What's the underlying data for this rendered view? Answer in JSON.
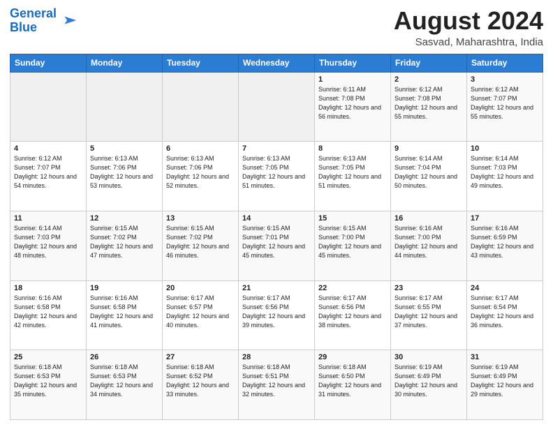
{
  "header": {
    "logo_line1": "General",
    "logo_line2": "Blue",
    "month": "August 2024",
    "location": "Sasvad, Maharashtra, India"
  },
  "weekdays": [
    "Sunday",
    "Monday",
    "Tuesday",
    "Wednesday",
    "Thursday",
    "Friday",
    "Saturday"
  ],
  "weeks": [
    [
      {
        "day": "",
        "empty": true
      },
      {
        "day": "",
        "empty": true
      },
      {
        "day": "",
        "empty": true
      },
      {
        "day": "",
        "empty": true
      },
      {
        "day": "1",
        "sunrise": "Sunrise: 6:11 AM",
        "sunset": "Sunset: 7:08 PM",
        "daylight": "Daylight: 12 hours and 56 minutes."
      },
      {
        "day": "2",
        "sunrise": "Sunrise: 6:12 AM",
        "sunset": "Sunset: 7:08 PM",
        "daylight": "Daylight: 12 hours and 55 minutes."
      },
      {
        "day": "3",
        "sunrise": "Sunrise: 6:12 AM",
        "sunset": "Sunset: 7:07 PM",
        "daylight": "Daylight: 12 hours and 55 minutes."
      }
    ],
    [
      {
        "day": "4",
        "sunrise": "Sunrise: 6:12 AM",
        "sunset": "Sunset: 7:07 PM",
        "daylight": "Daylight: 12 hours and 54 minutes."
      },
      {
        "day": "5",
        "sunrise": "Sunrise: 6:13 AM",
        "sunset": "Sunset: 7:06 PM",
        "daylight": "Daylight: 12 hours and 53 minutes."
      },
      {
        "day": "6",
        "sunrise": "Sunrise: 6:13 AM",
        "sunset": "Sunset: 7:06 PM",
        "daylight": "Daylight: 12 hours and 52 minutes."
      },
      {
        "day": "7",
        "sunrise": "Sunrise: 6:13 AM",
        "sunset": "Sunset: 7:05 PM",
        "daylight": "Daylight: 12 hours and 51 minutes."
      },
      {
        "day": "8",
        "sunrise": "Sunrise: 6:13 AM",
        "sunset": "Sunset: 7:05 PM",
        "daylight": "Daylight: 12 hours and 51 minutes."
      },
      {
        "day": "9",
        "sunrise": "Sunrise: 6:14 AM",
        "sunset": "Sunset: 7:04 PM",
        "daylight": "Daylight: 12 hours and 50 minutes."
      },
      {
        "day": "10",
        "sunrise": "Sunrise: 6:14 AM",
        "sunset": "Sunset: 7:03 PM",
        "daylight": "Daylight: 12 hours and 49 minutes."
      }
    ],
    [
      {
        "day": "11",
        "sunrise": "Sunrise: 6:14 AM",
        "sunset": "Sunset: 7:03 PM",
        "daylight": "Daylight: 12 hours and 48 minutes."
      },
      {
        "day": "12",
        "sunrise": "Sunrise: 6:15 AM",
        "sunset": "Sunset: 7:02 PM",
        "daylight": "Daylight: 12 hours and 47 minutes."
      },
      {
        "day": "13",
        "sunrise": "Sunrise: 6:15 AM",
        "sunset": "Sunset: 7:02 PM",
        "daylight": "Daylight: 12 hours and 46 minutes."
      },
      {
        "day": "14",
        "sunrise": "Sunrise: 6:15 AM",
        "sunset": "Sunset: 7:01 PM",
        "daylight": "Daylight: 12 hours and 45 minutes."
      },
      {
        "day": "15",
        "sunrise": "Sunrise: 6:15 AM",
        "sunset": "Sunset: 7:00 PM",
        "daylight": "Daylight: 12 hours and 45 minutes."
      },
      {
        "day": "16",
        "sunrise": "Sunrise: 6:16 AM",
        "sunset": "Sunset: 7:00 PM",
        "daylight": "Daylight: 12 hours and 44 minutes."
      },
      {
        "day": "17",
        "sunrise": "Sunrise: 6:16 AM",
        "sunset": "Sunset: 6:59 PM",
        "daylight": "Daylight: 12 hours and 43 minutes."
      }
    ],
    [
      {
        "day": "18",
        "sunrise": "Sunrise: 6:16 AM",
        "sunset": "Sunset: 6:58 PM",
        "daylight": "Daylight: 12 hours and 42 minutes."
      },
      {
        "day": "19",
        "sunrise": "Sunrise: 6:16 AM",
        "sunset": "Sunset: 6:58 PM",
        "daylight": "Daylight: 12 hours and 41 minutes."
      },
      {
        "day": "20",
        "sunrise": "Sunrise: 6:17 AM",
        "sunset": "Sunset: 6:57 PM",
        "daylight": "Daylight: 12 hours and 40 minutes."
      },
      {
        "day": "21",
        "sunrise": "Sunrise: 6:17 AM",
        "sunset": "Sunset: 6:56 PM",
        "daylight": "Daylight: 12 hours and 39 minutes."
      },
      {
        "day": "22",
        "sunrise": "Sunrise: 6:17 AM",
        "sunset": "Sunset: 6:56 PM",
        "daylight": "Daylight: 12 hours and 38 minutes."
      },
      {
        "day": "23",
        "sunrise": "Sunrise: 6:17 AM",
        "sunset": "Sunset: 6:55 PM",
        "daylight": "Daylight: 12 hours and 37 minutes."
      },
      {
        "day": "24",
        "sunrise": "Sunrise: 6:17 AM",
        "sunset": "Sunset: 6:54 PM",
        "daylight": "Daylight: 12 hours and 36 minutes."
      }
    ],
    [
      {
        "day": "25",
        "sunrise": "Sunrise: 6:18 AM",
        "sunset": "Sunset: 6:53 PM",
        "daylight": "Daylight: 12 hours and 35 minutes."
      },
      {
        "day": "26",
        "sunrise": "Sunrise: 6:18 AM",
        "sunset": "Sunset: 6:53 PM",
        "daylight": "Daylight: 12 hours and 34 minutes."
      },
      {
        "day": "27",
        "sunrise": "Sunrise: 6:18 AM",
        "sunset": "Sunset: 6:52 PM",
        "daylight": "Daylight: 12 hours and 33 minutes."
      },
      {
        "day": "28",
        "sunrise": "Sunrise: 6:18 AM",
        "sunset": "Sunset: 6:51 PM",
        "daylight": "Daylight: 12 hours and 32 minutes."
      },
      {
        "day": "29",
        "sunrise": "Sunrise: 6:18 AM",
        "sunset": "Sunset: 6:50 PM",
        "daylight": "Daylight: 12 hours and 31 minutes."
      },
      {
        "day": "30",
        "sunrise": "Sunrise: 6:19 AM",
        "sunset": "Sunset: 6:49 PM",
        "daylight": "Daylight: 12 hours and 30 minutes."
      },
      {
        "day": "31",
        "sunrise": "Sunrise: 6:19 AM",
        "sunset": "Sunset: 6:49 PM",
        "daylight": "Daylight: 12 hours and 29 minutes."
      }
    ]
  ]
}
